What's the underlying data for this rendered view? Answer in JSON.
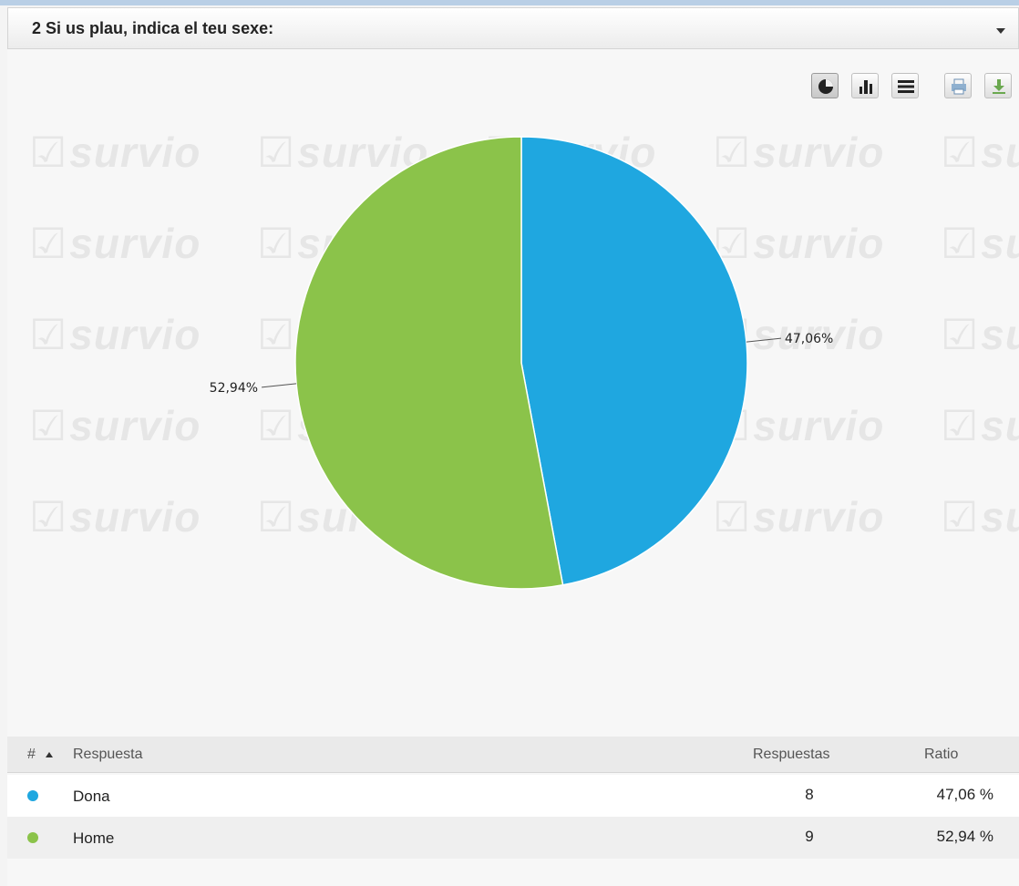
{
  "question": {
    "title": "2 Si us plau, indica el teu sexe:"
  },
  "watermark_text": "survio",
  "toolbar": {
    "buttons": [
      {
        "icon": "pie-chart-icon",
        "active": true
      },
      {
        "icon": "bar-chart-icon",
        "active": false
      },
      {
        "icon": "table-view-icon",
        "active": false
      },
      {
        "icon": "print-icon",
        "active": false
      },
      {
        "icon": "download-icon",
        "active": false
      }
    ]
  },
  "chart_data": {
    "type": "pie",
    "slices": [
      {
        "label": "Dona",
        "value": 47.06,
        "display": "47,06%",
        "color": "#1fa7e0"
      },
      {
        "label": "Home",
        "value": 52.94,
        "display": "52,94%",
        "color": "#8bc34a"
      }
    ]
  },
  "table": {
    "headers": {
      "index": "#",
      "answer": "Respuesta",
      "count": "Respuestas",
      "ratio": "Ratio"
    },
    "rows": [
      {
        "label": "Dona",
        "count": "8",
        "ratio": "47,06 %",
        "color": "#1fa7e0"
      },
      {
        "label": "Home",
        "count": "9",
        "ratio": "52,94 %",
        "color": "#8bc34a"
      }
    ]
  }
}
